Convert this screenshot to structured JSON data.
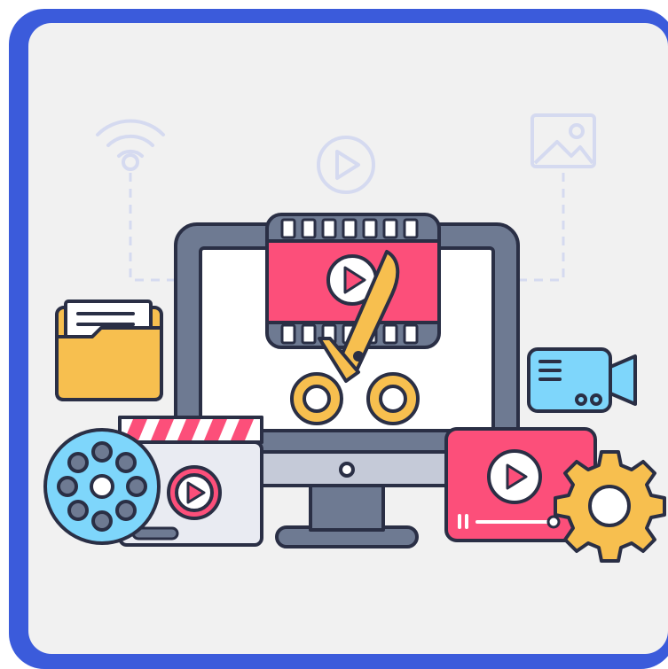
{
  "illustration": {
    "subject": "video editing",
    "icons": [
      "wifi-icon",
      "play-circle-icon",
      "image-icon",
      "computer-monitor",
      "film-strip-icon",
      "play-icon",
      "scissors-icon",
      "folder-icon",
      "document-icon",
      "video-camera-icon",
      "film-reel-icon",
      "clapperboard-icon",
      "video-player-icon",
      "gear-icon"
    ]
  },
  "colors": {
    "frame": "#3b5bdb",
    "background": "#f1f1f1",
    "outline": "#2a2f45",
    "pink": "#fc4f7a",
    "yellow": "#f7bf4f",
    "blue": "#7ed6fb",
    "gray": "#6e7a92",
    "light": "#e9ebf2",
    "faint": "#d5daf0"
  }
}
